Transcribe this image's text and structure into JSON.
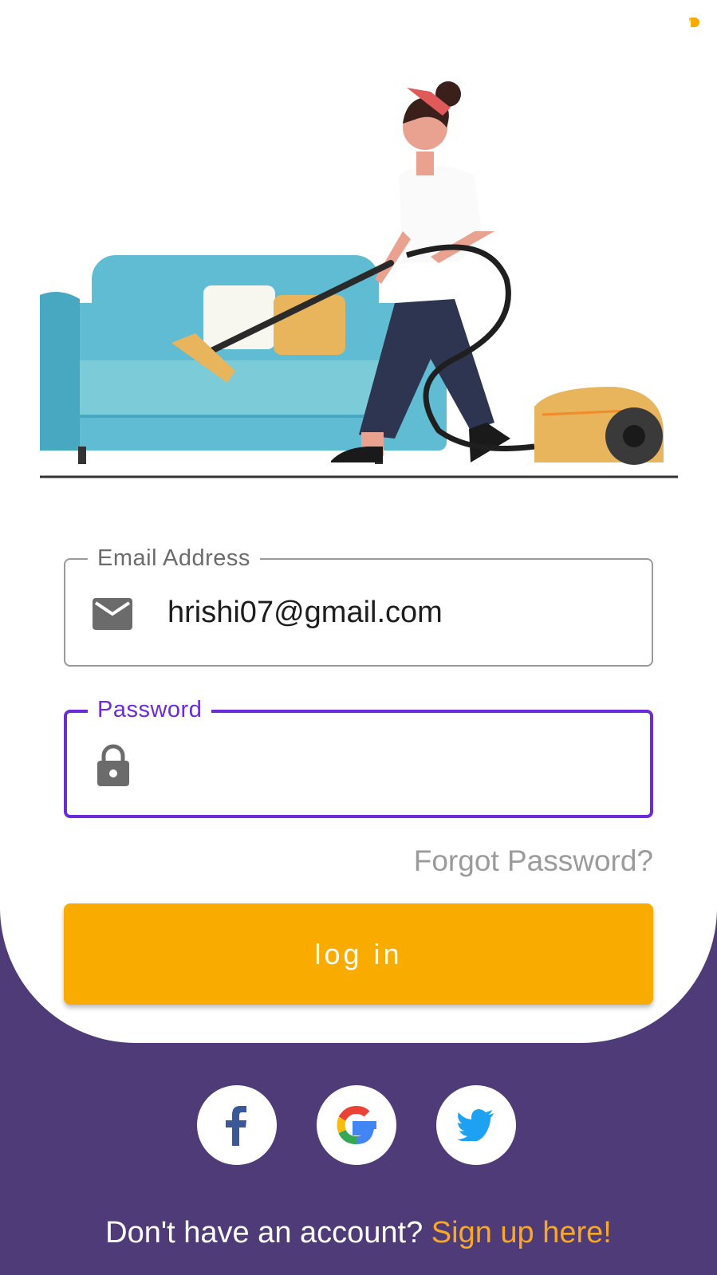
{
  "form": {
    "email": {
      "label": "Email Address",
      "value": "hrishi07@gmail.com",
      "icon": "envelope-icon"
    },
    "password": {
      "label": "Password",
      "value": "",
      "icon": "lock-icon",
      "focused": true
    },
    "forgot_label": "Forgot Password?",
    "login_label": "log in"
  },
  "social": [
    {
      "name": "facebook",
      "icon": "facebook-icon",
      "color": "#3b5998"
    },
    {
      "name": "google",
      "icon": "google-icon"
    },
    {
      "name": "twitter",
      "icon": "twitter-icon",
      "color": "#1da1f2"
    }
  ],
  "footer": {
    "prompt": "Don't have an account?",
    "signup_label": "Sign up here!"
  },
  "colors": {
    "accent": "#f9ab00",
    "focus": "#6c2bd9",
    "background": "#4e3b78",
    "link": "#f9a825"
  }
}
